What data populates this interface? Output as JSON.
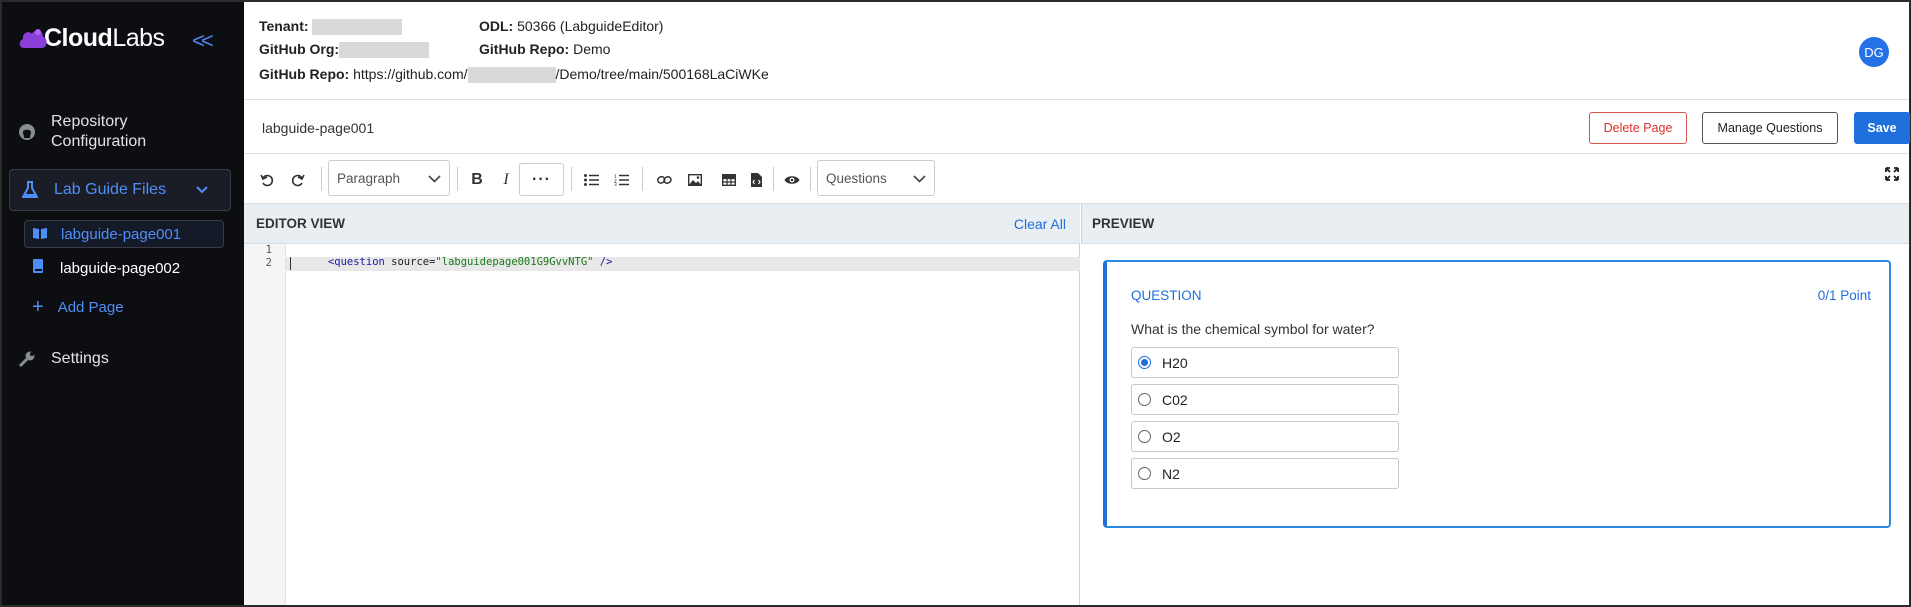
{
  "brand": {
    "logo_text_bold": "Cloud",
    "logo_text_light": "Labs",
    "collapse_icon": "<<"
  },
  "sidebar": {
    "repo_config_line1": "Repository",
    "repo_config_line2": "Configuration",
    "lab_guide_files": "Lab Guide Files",
    "files": [
      "labguide-page001",
      "labguide-page002"
    ],
    "add_page": "Add Page",
    "settings": "Settings"
  },
  "header": {
    "tenant_label": "Tenant:",
    "odl_label": "ODL:",
    "odl_value": "50366 (LabguideEditor)",
    "github_org_label": "GitHub Org:",
    "github_repo_label": "GitHub Repo:",
    "github_repo_value": "Demo",
    "github_repo_url_label": "GitHub Repo:",
    "github_repo_url_prefix": "https://github.com/",
    "github_repo_url_suffix": "/Demo/tree/main/500168LaCiWKe",
    "avatar_initials": "DG"
  },
  "titlebar": {
    "page_title": "labguide-page001",
    "delete_label": "Delete Page",
    "manage_label": "Manage Questions",
    "save_label": "Save"
  },
  "toolbar": {
    "paragraph_select": "Paragraph",
    "questions_select": "Questions"
  },
  "editor": {
    "header": "EDITOR VIEW",
    "clear_all": "Clear All",
    "line_numbers": [
      "1",
      "2"
    ],
    "code": {
      "open": "<question ",
      "attr": "source=",
      "value": "\"labguidepage001G9GvvNTG\"",
      "close": " />"
    }
  },
  "preview": {
    "header": "PREVIEW",
    "question_label": "QUESTION",
    "points": "0/1 Point",
    "question_text": "What is the chemical symbol for water?",
    "options": [
      {
        "label": "H20",
        "checked": true
      },
      {
        "label": "C02",
        "checked": false
      },
      {
        "label": "O2",
        "checked": false
      },
      {
        "label": "N2",
        "checked": false
      }
    ]
  },
  "colors": {
    "accent": "#1f6fdc",
    "sidebar_bg": "#0d0e12",
    "delete": "#d9312c"
  }
}
